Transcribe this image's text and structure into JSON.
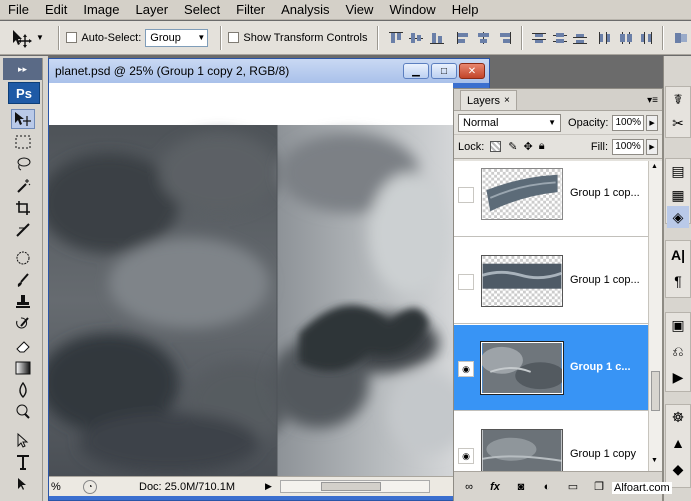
{
  "menu": [
    "File",
    "Edit",
    "Image",
    "Layer",
    "Select",
    "Filter",
    "Analysis",
    "View",
    "Window",
    "Help"
  ],
  "options": {
    "auto_select_label": "Auto-Select:",
    "auto_select_value": "Group",
    "transform_label": "Show Transform Controls"
  },
  "toolbox": {
    "logo": "Ps"
  },
  "document": {
    "title": "planet.psd @ 25% (Group 1 copy 2, RGB/8)",
    "zoom": "%",
    "doc_info": "Doc: 25.0M/710.1M"
  },
  "layers_panel": {
    "tab": "Layers",
    "blend_mode": "Normal",
    "opacity_label": "Opacity:",
    "opacity_value": "100%",
    "lock_label": "Lock:",
    "fill_label": "Fill:",
    "fill_value": "100%",
    "layers": [
      {
        "name": "Group 1 cop...",
        "visible": false,
        "selected": false
      },
      {
        "name": "Group 1 cop...",
        "visible": false,
        "selected": false
      },
      {
        "name": "Group 1 c...",
        "visible": true,
        "selected": true
      },
      {
        "name": "Group 1 copy",
        "visible": true,
        "selected": false
      }
    ]
  },
  "watermark": "Alfoart.com",
  "colors": {
    "selection": "#3894f5",
    "title_blue": "#3b6fcf",
    "ps_blue": "#1f5aa6"
  }
}
